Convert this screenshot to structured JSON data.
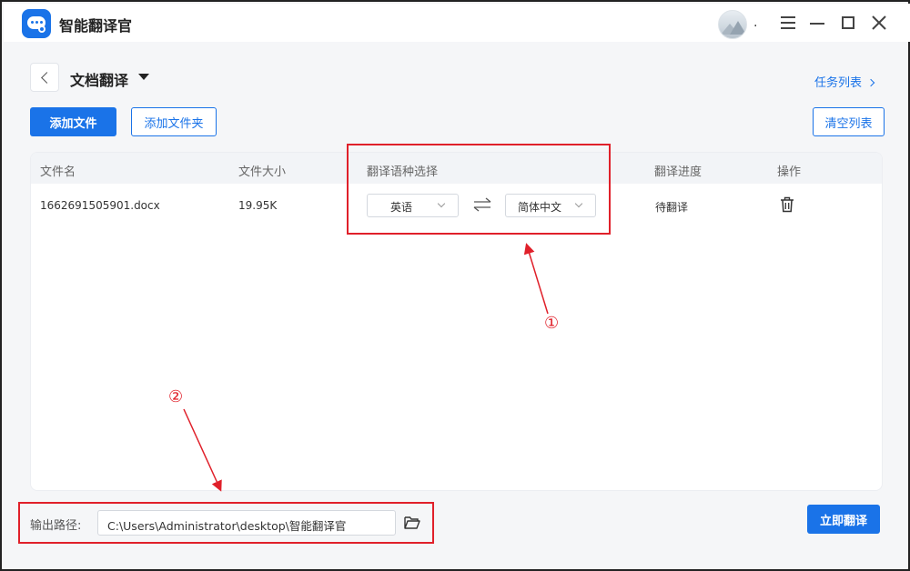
{
  "app": {
    "name": "智能翻译官",
    "user_name": "."
  },
  "window_controls": {
    "menu": "menu-icon",
    "minimize": "minimize-icon",
    "maximize": "maximize-icon",
    "close": "close-icon"
  },
  "header": {
    "back": "chevron-left-icon",
    "title": "文档翻译",
    "task_list_link": "任务列表"
  },
  "toolbar": {
    "add_file": "添加文件",
    "add_folder": "添加文件夹",
    "clear_list": "清空列表"
  },
  "table": {
    "columns": [
      "文件名",
      "文件大小",
      "翻译语种选择",
      "翻译进度",
      "操作"
    ],
    "rows": [
      {
        "file_name": "1662691505901.docx",
        "file_size": "19.95K",
        "source_lang": "英语",
        "target_lang": "简体中文",
        "progress": "待翻译",
        "action_icon": "trash-icon"
      }
    ]
  },
  "annotations": {
    "marker_1": "①",
    "marker_2": "②",
    "color": "#e0202a"
  },
  "output": {
    "label": "输出路径:",
    "path": "C:\\Users\\Administrator\\desktop\\智能翻译官",
    "folder_icon": "folder-open-icon",
    "translate_button": "立即翻译"
  },
  "colors": {
    "accent": "#1a73e8",
    "annotation": "#e0202a"
  }
}
